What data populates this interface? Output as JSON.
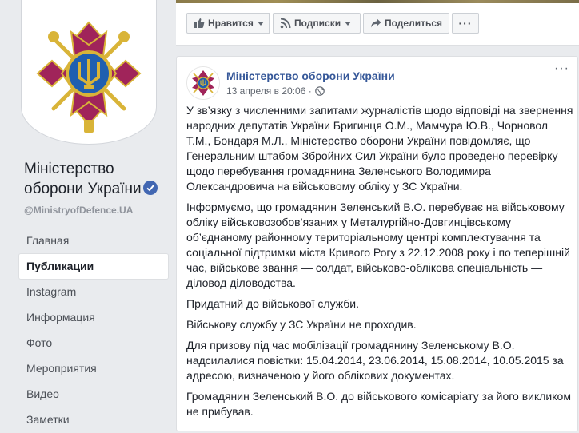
{
  "page": {
    "name": "Міністерство оборони України",
    "handle": "@MinistryofDefence.UA"
  },
  "nav": {
    "items": [
      {
        "label": "Главная",
        "active": false
      },
      {
        "label": "Публикации",
        "active": true
      },
      {
        "label": "Instagram",
        "active": false
      },
      {
        "label": "Информация",
        "active": false
      },
      {
        "label": "Фото",
        "active": false
      },
      {
        "label": "Мероприятия",
        "active": false
      },
      {
        "label": "Видео",
        "active": false
      },
      {
        "label": "Заметки",
        "active": false
      }
    ]
  },
  "actions": {
    "like_label": "Нравится",
    "subscriptions_label": "Подписки",
    "share_label": "Поделиться",
    "more_label": "···"
  },
  "post": {
    "author": "Міністерство оборони України",
    "date": "13 апреля в 20:06 ·",
    "menu_label": "···",
    "paragraphs": [
      "У зв’язку з численними запитами журналістів щодо відповіді на звернення народних депутатів України Бригинця О.М., Мамчура Ю.В., Чорновол Т.М., Бондаря М.Л., Міністерство оборони України повідомляє, що Генеральним штабом Збройних Сил України було проведено перевірку щодо перебування громадянина Зеленського Володимира Олександровича на військовому обліку у ЗС України.",
      "Інформуємо, що громадянин Зеленський В.О. перебуває на військовому обліку військовозобов’язаних у Металургійно-Довгинцівському об’єднаному районному територіальному центрі комплектування та соціальної підтримки міста Кривого Рогу з 22.12.2008 року і по теперішній час, військове звання — солдат, військово-облікова спеціальність — діловод діловодства.",
      "Придатний до військової служби.",
      "Військову службу у ЗС України не проходив.",
      "Для призову під час мобілізації громадянину Зеленському В.О. надсилалися повістки: 15.04.2014, 23.06.2014, 15.08.2014, 10.05.2015 за адресою, визначеною у його облікових документах.",
      "Громадянин Зеленський В.О. до військового комісаріату за його викликом не прибував."
    ]
  },
  "colors": {
    "brand_blue": "#4267b2",
    "link_blue": "#365899",
    "emblem_crimson": "#a0245a",
    "emblem_gold": "#d9b438",
    "emblem_blue": "#1f5fb0"
  },
  "icons": {
    "like": "thumbs-up-icon",
    "subscriptions": "rss-icon",
    "share": "share-arrow-icon",
    "verified": "verified-check-icon",
    "privacy": "globe-icon"
  }
}
